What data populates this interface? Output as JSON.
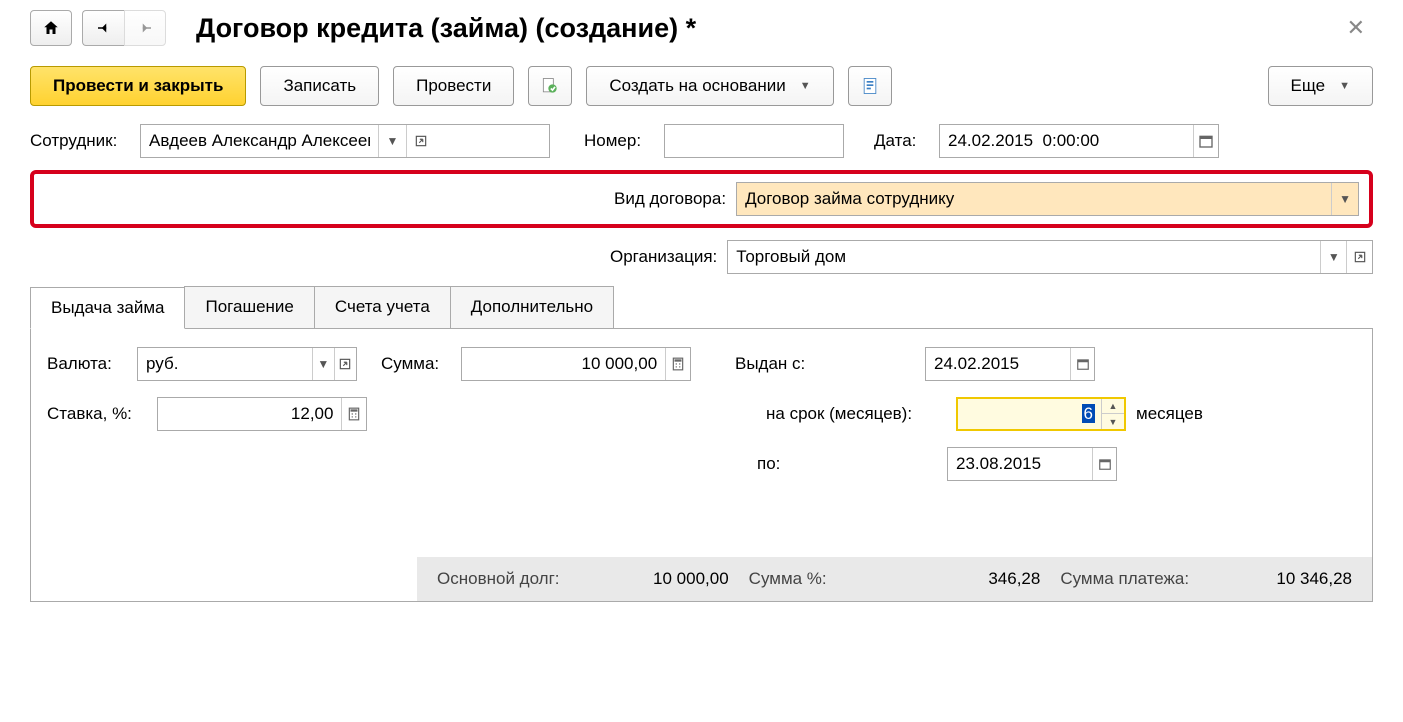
{
  "header": {
    "title": "Договор кредита (займа) (создание) *"
  },
  "toolbar": {
    "post_close": "Провести и закрыть",
    "save": "Записать",
    "post": "Провести",
    "create_based": "Создать на основании",
    "more": "Еще"
  },
  "form": {
    "employee_label": "Сотрудник:",
    "employee_value": "Авдеев Александр Алексеевич",
    "number_label": "Номер:",
    "number_value": "",
    "date_label": "Дата:",
    "date_value": "24.02.2015  0:00:00",
    "contract_type_label": "Вид договора:",
    "contract_type_value": "Договор займа сотруднику",
    "org_label": "Организация:",
    "org_value": "Торговый дом"
  },
  "tabs": {
    "t1": "Выдача займа",
    "t2": "Погашение",
    "t3": "Счета учета",
    "t4": "Дополнительно"
  },
  "loan": {
    "currency_label": "Валюта:",
    "currency_value": "руб.",
    "sum_label": "Сумма:",
    "sum_value": "10 000,00",
    "rate_label": "Ставка, %:",
    "rate_value": "12,00",
    "issued_label": "Выдан с:",
    "issued_value": "24.02.2015",
    "term_label": "на срок (месяцев):",
    "term_value": "6",
    "term_unit": "месяцев",
    "until_label": "по:",
    "until_value": "23.08.2015"
  },
  "status": {
    "principal_label": "Основной долг:",
    "principal_value": "10 000,00",
    "pct_label": "Сумма %:",
    "pct_value": "346,28",
    "payment_label": "Сумма платежа:",
    "payment_value": "10 346,28"
  }
}
